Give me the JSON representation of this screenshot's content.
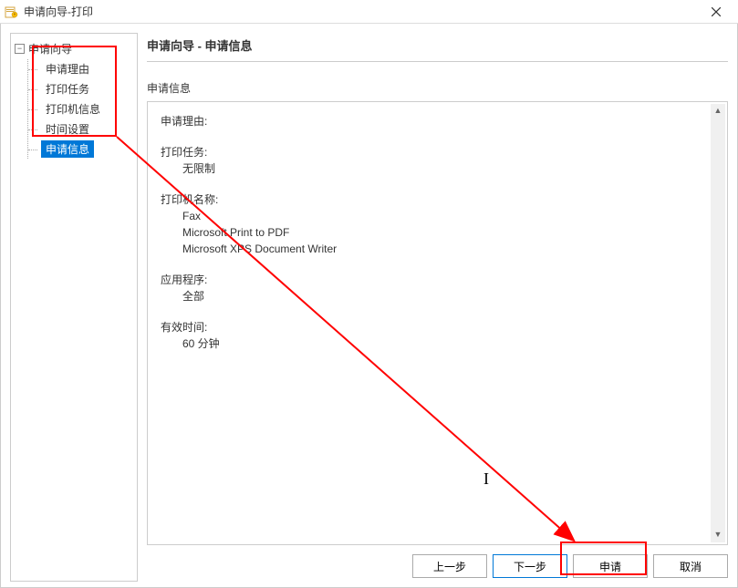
{
  "titlebar": {
    "title": "申请向导-打印"
  },
  "sidebar": {
    "root": "申请向导",
    "items": [
      {
        "label": "申请理由"
      },
      {
        "label": "打印任务"
      },
      {
        "label": "打印机信息"
      },
      {
        "label": "时间设置"
      },
      {
        "label": "申请信息",
        "selected": true
      }
    ]
  },
  "main": {
    "header": "申请向导 - 申请信息",
    "section_label": "申请信息",
    "info": {
      "reason_label": "申请理由:",
      "reason_value": "",
      "task_label": "打印任务:",
      "task_value": "无限制",
      "printer_label": "打印机名称:",
      "printer_values": [
        "Fax",
        "Microsoft Print to PDF",
        "Microsoft XPS Document Writer"
      ],
      "app_label": "应用程序:",
      "app_value": "全部",
      "time_label": "有效时间:",
      "time_value": "60 分钟"
    }
  },
  "buttons": {
    "prev": "上一步",
    "next": "下一步",
    "apply": "申请",
    "cancel": "取消"
  }
}
